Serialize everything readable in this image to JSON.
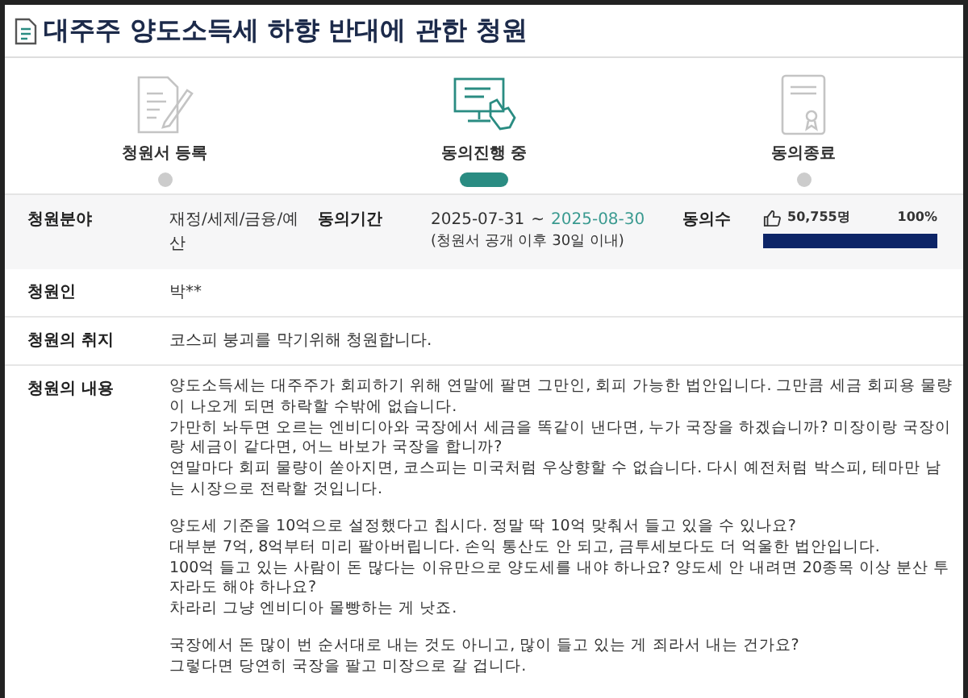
{
  "title": "대주주 양도소득세 하향 반대에 관한 청원",
  "steps": [
    {
      "label": "청원서 등록",
      "selected": false,
      "kind": "register"
    },
    {
      "label": "동의진행 중",
      "selected": true,
      "kind": "progress"
    },
    {
      "label": "동의종료",
      "selected": false,
      "kind": "end"
    }
  ],
  "info": {
    "category_label": "청원분야",
    "category": "재정/세제/금융/예산",
    "period_label": "동의기간",
    "period_start": "2025-07-31",
    "period_sep": "~",
    "period_end": "2025-08-30",
    "period_note": "(청원서 공개 이후 30일 이내)",
    "count_label": "동의수",
    "count": "50,755명",
    "percent": "100%",
    "level": 1
  },
  "petitioner": {
    "label": "청원인",
    "value": "박**"
  },
  "purpose": {
    "label": "청원의 취지",
    "value": "코스피 붕괴를 막기위해 청원합니다."
  },
  "content": {
    "label": "청원의 내용",
    "paragraphs": [
      [
        "양도소득세는 대주주가 회피하기 위해 연말에 팔면 그만인, 회피 가능한 법안입니다. 그만큼 세금 회피용 물량이 나오게 되면 하락할 수밖에 없습니다.",
        "가만히 놔두면 오르는 엔비디아와 국장에서 세금을 똑같이 낸다면, 누가 국장을 하겠습니까? 미장이랑 국장이랑 세금이 같다면, 어느 바보가 국장을 합니까?",
        "연말마다 회피 물량이 쏟아지면, 코스피는 미국처럼 우상향할 수 없습니다. 다시 예전처럼 박스피, 테마만 남는 시장으로 전락할 것입니다."
      ],
      [
        "양도세 기준을 10억으로 설정했다고 칩시다. 정말 딱 10억 맞춰서 들고 있을 수 있나요?",
        "대부분 7억, 8억부터 미리 팔아버립니다. 손익 통산도 안 되고, 금투세보다도 더 억울한 법안입니다.",
        "100억 들고 있는 사람이 돈 많다는 이유만으로 양도세를 내야 하나요? 양도세 안 내려면 20종목 이상 분산 투자라도 해야 하나요?",
        "차라리 그냥 엔비디아 몰빵하는 게 낫죠."
      ],
      [
        "국장에서 돈 많이 번 순서대로 내는 것도 아니고, 많이 들고 있는 게 죄라서 내는 건가요?",
        "그렇다면 당연히 국장을 팔고 미장으로 갈 겁니다."
      ]
    ]
  }
}
